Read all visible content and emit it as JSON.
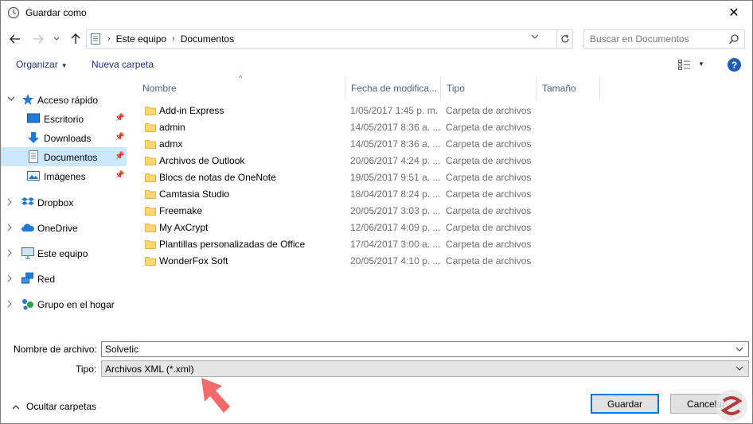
{
  "window": {
    "title": "Guardar como",
    "close_glyph": "✕"
  },
  "navbar": {
    "breadcrumbs": [
      "Este equipo",
      "Documentos"
    ],
    "search_placeholder": "Buscar en Documentos"
  },
  "commandbar": {
    "organizar_label": "Organizar",
    "nueva_carpeta_label": "Nueva carpeta",
    "help_label": "?"
  },
  "navpane": {
    "items": [
      {
        "label": "Acceso rápido",
        "icon": "star-icon",
        "expanded": true
      },
      {
        "label": "Escritorio",
        "icon": "desktop-icon",
        "pinned": true
      },
      {
        "label": "Downloads",
        "icon": "download-icon",
        "pinned": true
      },
      {
        "label": "Documentos",
        "icon": "document-icon",
        "pinned": true,
        "selected": true
      },
      {
        "label": "Imágenes",
        "icon": "pictures-icon",
        "pinned": true
      },
      {
        "label": "Dropbox",
        "icon": "dropbox-icon"
      },
      {
        "label": "OneDrive",
        "icon": "cloud-icon"
      },
      {
        "label": "Este equipo",
        "icon": "computer-icon"
      },
      {
        "label": "Red",
        "icon": "network-icon"
      },
      {
        "label": "Grupo en el hogar",
        "icon": "homegroup-icon"
      }
    ]
  },
  "filelist": {
    "columns": [
      "Nombre",
      "Fecha de modifica...",
      "Tipo",
      "Tamaño"
    ],
    "rows": [
      {
        "name": "Add-in Express",
        "date": "1/05/2017 1:45 p. m.",
        "type": "Carpeta de archivos"
      },
      {
        "name": "admin",
        "date": "14/05/2017 8:36 a. ...",
        "type": "Carpeta de archivos"
      },
      {
        "name": "admx",
        "date": "14/05/2017 8:36 a. ...",
        "type": "Carpeta de archivos"
      },
      {
        "name": "Archivos de Outlook",
        "date": "20/06/2017 4:24 p. ...",
        "type": "Carpeta de archivos"
      },
      {
        "name": "Blocs de notas de OneNote",
        "date": "19/05/2017 9:51 a. ...",
        "type": "Carpeta de archivos"
      },
      {
        "name": "Camtasia Studio",
        "date": "18/04/2017 8:24 p. ...",
        "type": "Carpeta de archivos"
      },
      {
        "name": "Freemake",
        "date": "20/05/2017 3:03 p. ...",
        "type": "Carpeta de archivos"
      },
      {
        "name": "My AxCrypt",
        "date": "12/06/2017 4:09 p. ...",
        "type": "Carpeta de archivos"
      },
      {
        "name": "Plantillas personalizadas de Office",
        "date": "17/04/2017 3:00 a. ...",
        "type": "Carpeta de archivos"
      },
      {
        "name": "WonderFox Soft",
        "date": "20/05/2017 4:10 p. ...",
        "type": "Carpeta de archivos"
      }
    ]
  },
  "footer": {
    "filename_label": "Nombre de archivo:",
    "filename_value": "Solvetic",
    "type_label": "Tipo:",
    "type_value": "Archivos XML (*.xml)",
    "hide_folders_label": "Ocultar carpetas",
    "save_label": "Guardar",
    "cancel_label": "Cancelar"
  },
  "colors": {
    "accent": "#0078d7",
    "selection": "#cce8ff",
    "folder": "#ffd76e",
    "annotation_arrow": "#f26b6b",
    "link_text": "#1e3287"
  }
}
